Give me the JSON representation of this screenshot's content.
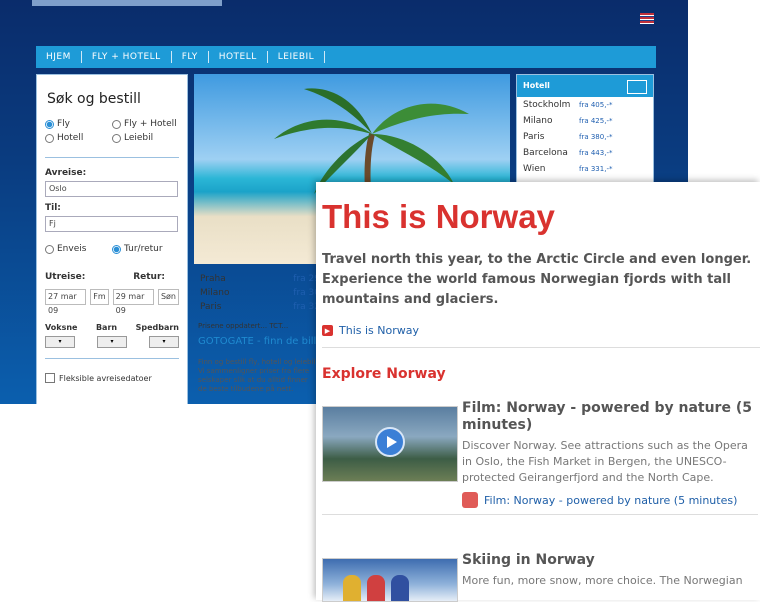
{
  "back_window": {
    "nav": [
      "HJEM",
      "FLY + HOTELL",
      "FLY",
      "HOTELL",
      "LEIEBIL"
    ],
    "search": {
      "title": "Søk og bestill",
      "options": [
        "Fly",
        "Fly + Hotell",
        "Hotell",
        "Leiebil"
      ],
      "trip_types": [
        "Enveis",
        "Tur/retur"
      ],
      "from_label": "Avreise:",
      "from_value": "Oslo",
      "to_label": "Til:",
      "to_value": "Fj",
      "depart_label": "Utreise:",
      "return_label": "Retur:",
      "depart_date": "27 mar 09",
      "depart_time": "Fm",
      "return_date": "29 mar 09",
      "return_time": "Søn",
      "adults_label": "Voksne",
      "children_label": "Barn",
      "infants_label": "Spedbarn",
      "flexible_label": "Fleksible avreisedatoer"
    },
    "price_list": [
      {
        "city": "Praha",
        "price": "fra 29"
      },
      {
        "city": "Milano",
        "price": "fra 30"
      },
      {
        "city": "Paris",
        "price": "fra 32"
      }
    ],
    "credit": "Prisene oppdatert... TCT...",
    "gotogate": "GOTOGATE - finn de billigste",
    "blurb": "Finn og bestill fly, hotell og leiebil. Vi sammenligner priser fra flere selskaper slik at du alltid finner de beste tilbudene på nett.",
    "hotel": {
      "title": "Hotell",
      "rows": [
        {
          "city": "Stockholm",
          "price": "fra 405,-*"
        },
        {
          "city": "Milano",
          "price": "fra 425,-*"
        },
        {
          "city": "Paris",
          "price": "fra 380,-*"
        },
        {
          "city": "Barcelona",
          "price": "fra 443,-*"
        },
        {
          "city": "Wien",
          "price": "fra 331,-*"
        }
      ]
    }
  },
  "front_window": {
    "title": "This is Norway",
    "lead": "Travel north this year, to the Arctic Circle and even longer. Experience the world famous Norwegian fjords with tall mountains and glaciers.",
    "lead_link": "This is Norway",
    "explore": "Explore Norway",
    "film": {
      "title": "Film: Norway - powered by nature (5 minutes)",
      "desc": "Discover Norway. See attractions such as the Opera in Oslo, the Fish Market in Bergen, the UNESCO-protected Geirangerfjord and the North Cape.",
      "link": "Film: Norway - powered by nature (5 minutes)"
    },
    "ski": {
      "title": "Skiing in Norway",
      "desc": "More fun, more snow, more choice. The Norwegian"
    }
  }
}
